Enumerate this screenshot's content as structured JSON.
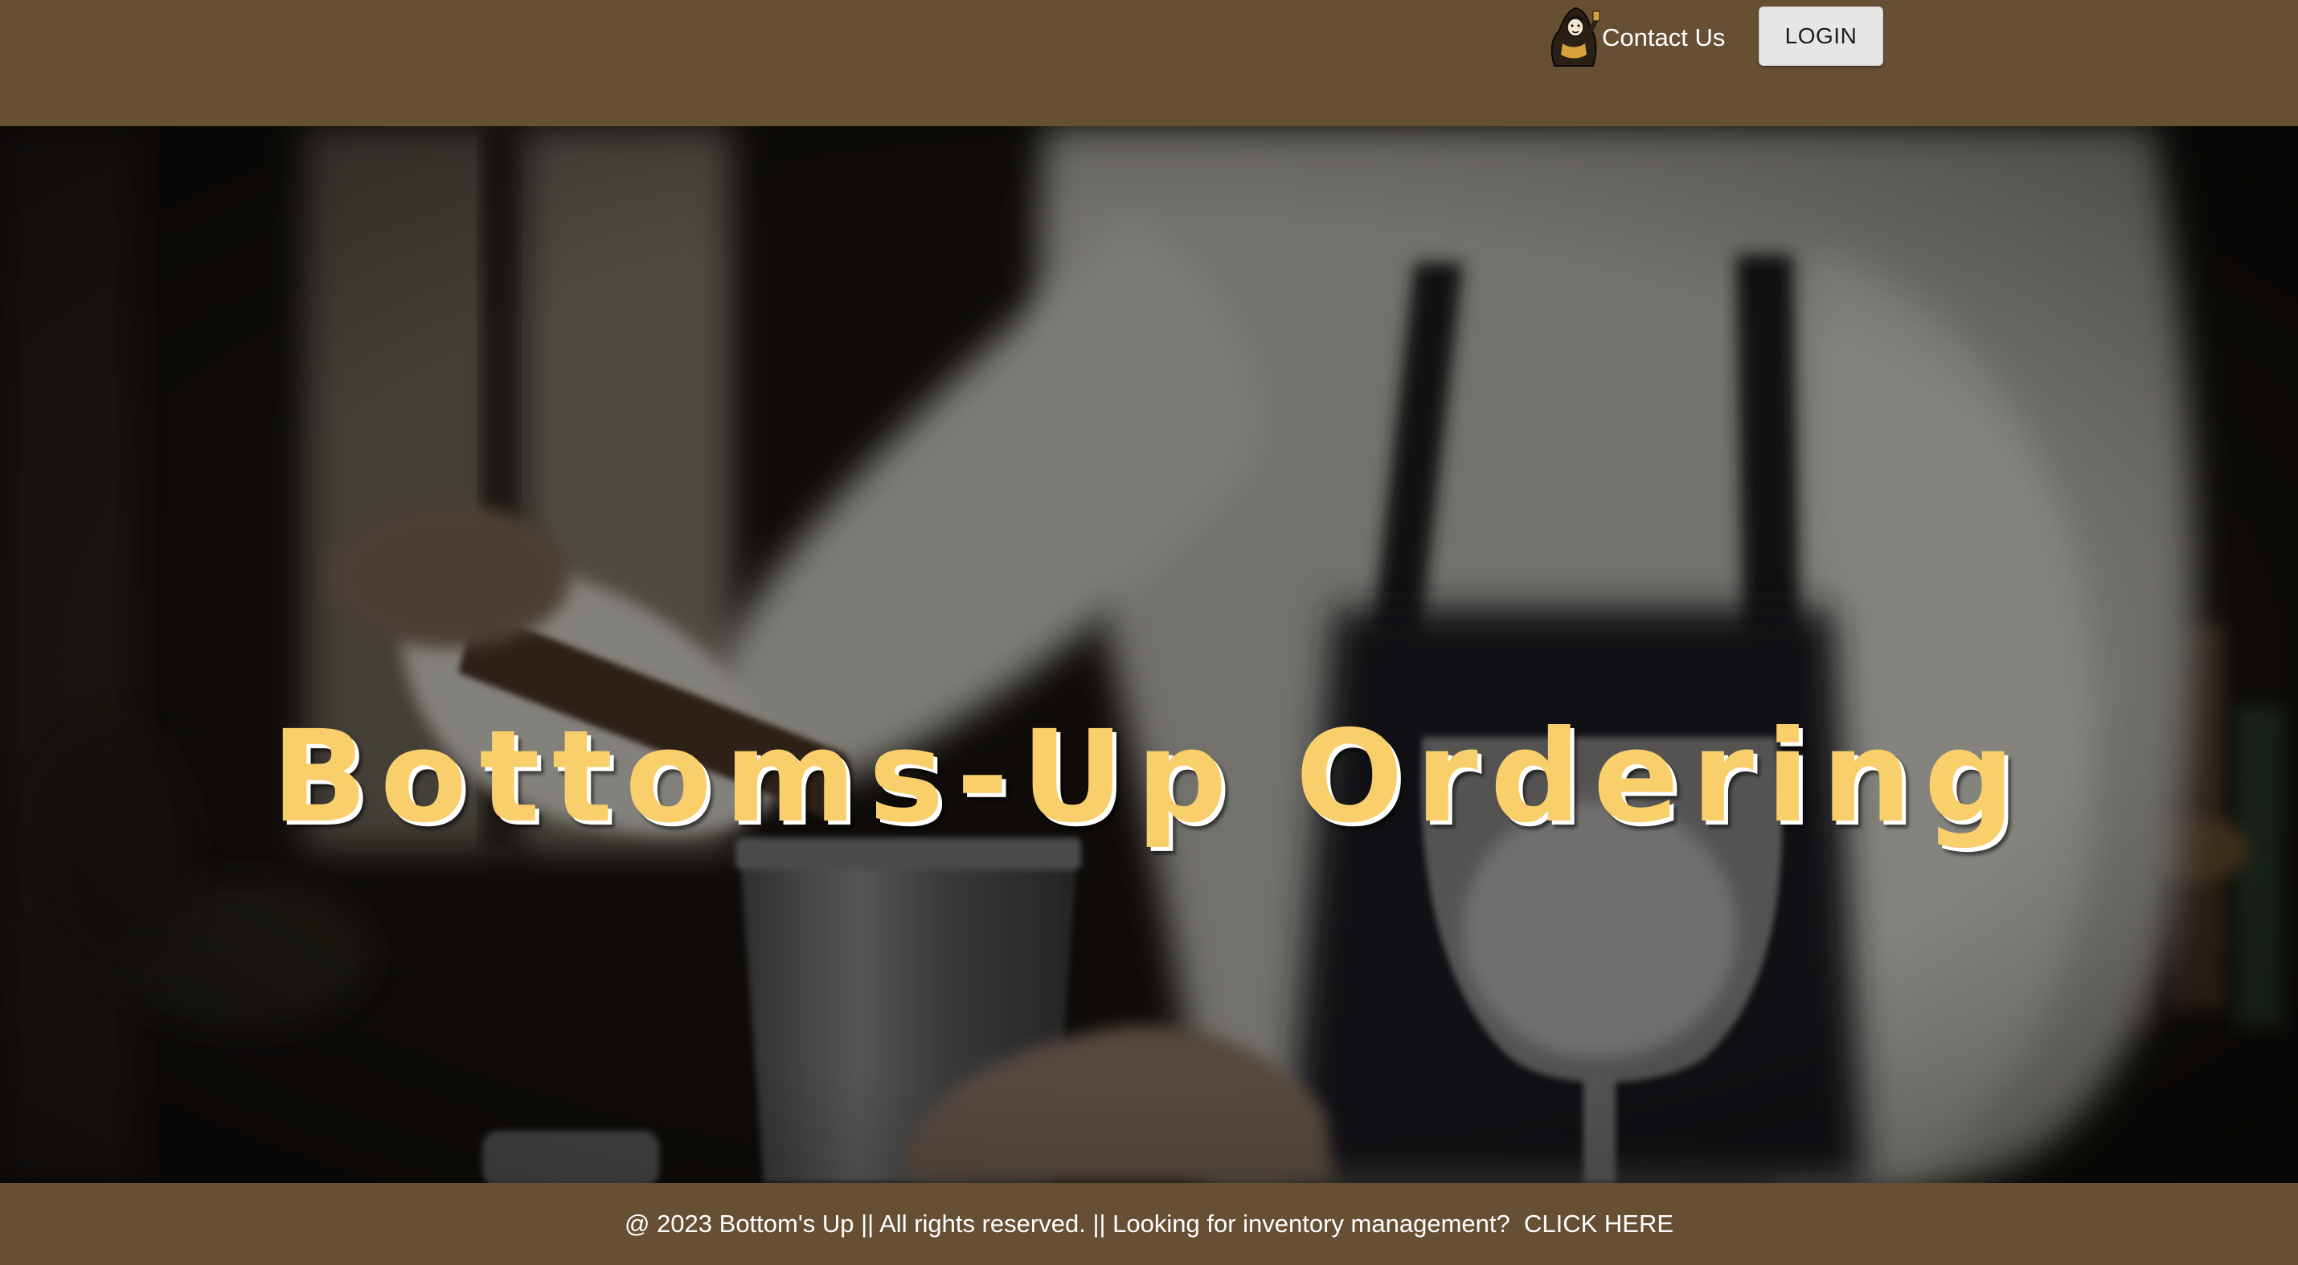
{
  "header": {
    "mascot_icon": "bartender-mascot-icon",
    "contact_label": "Contact Us",
    "login_label": "LOGIN"
  },
  "hero": {
    "title": "Bottoms-Up Ordering",
    "background": "photo-bartender-pouring-drink"
  },
  "footer": {
    "text": "@ 2023 Bottom's Up || All rights reserved. || Looking for inventory management?  ",
    "link_label": "CLICK HERE"
  },
  "colors": {
    "brand_brown": "#674f33",
    "title_gold": "#f9cf6c",
    "button_bg": "#e8e6e4"
  }
}
